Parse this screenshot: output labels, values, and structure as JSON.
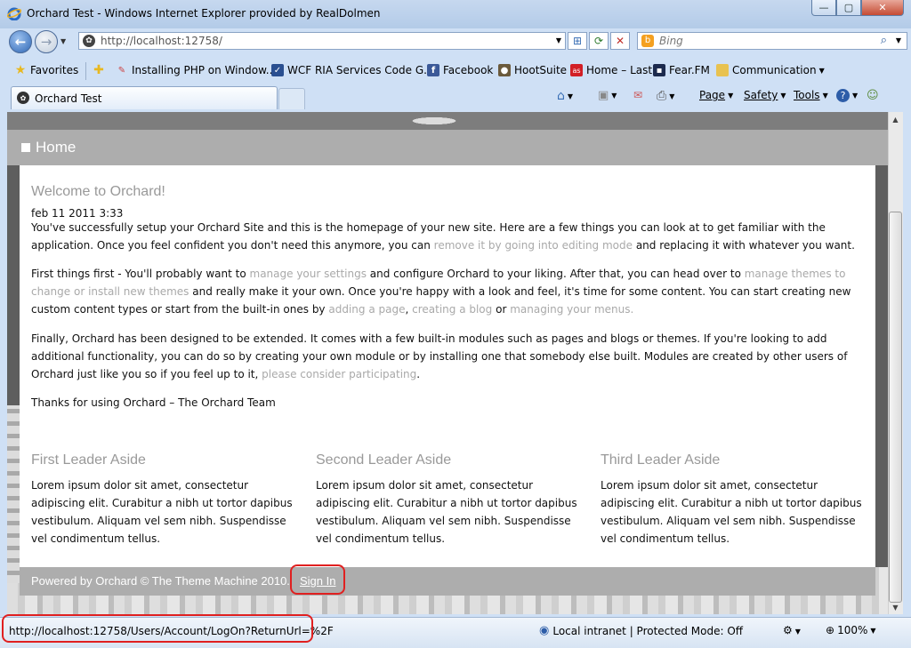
{
  "window": {
    "title": "Orchard Test - Windows Internet Explorer provided by RealDolmen",
    "min_glyph": "—",
    "max_glyph": "▢",
    "close_glyph": "✕"
  },
  "address_bar": {
    "url": "http://localhost:12758/",
    "search_placeholder": "Bing"
  },
  "favorites_bar": {
    "favorites_label": "Favorites",
    "items": [
      {
        "label": "Installing PHP on Window...",
        "icon": "pencil-icon"
      },
      {
        "label": "WCF RIA Services Code G...",
        "icon": "wcf-icon"
      },
      {
        "label": "Facebook",
        "icon": "facebook-icon"
      },
      {
        "label": "HootSuite",
        "icon": "owl-icon"
      },
      {
        "label": "Home – Last",
        "icon": "lastfm-icon"
      },
      {
        "label": "Fear.FM",
        "icon": "fearfm-icon"
      },
      {
        "label": "Communication",
        "icon": "folder-icon"
      }
    ]
  },
  "tabs": {
    "active_label": "Orchard Test"
  },
  "command_bar": {
    "page": "Page",
    "safety": "Safety",
    "tools": "Tools"
  },
  "site": {
    "home_title": "Home",
    "welcome_heading": "Welcome to Orchard!",
    "date": "feb 11 2011 3:33",
    "p1_a": "You've successfully setup your Orchard Site and this is the homepage of your new site. Here are a few things you can look at to get familiar with the application. Once you feel confident you don't need this anymore, you can ",
    "p1_link": "remove it by going into editing mode",
    "p1_b": " and replacing it with whatever you want.",
    "p2_a": "First things first - You'll probably want to ",
    "p2_link1": "manage your settings",
    "p2_b": " and configure Orchard to your liking. After that, you can head over to ",
    "p2_link2": "manage themes to change or install new themes",
    "p2_c": " and really make it your own. Once you're happy with a look and feel, it's time for some content. You can start creating new custom content types or start from the built-in ones by ",
    "p2_link3": "adding a page",
    "p2_d": ", ",
    "p2_link4": "creating a blog",
    "p2_e": " or ",
    "p2_link5": "managing your menus.",
    "p3_a": "Finally, Orchard has been designed to be extended. It comes with a few built-in modules such as pages and blogs or themes. If you're looking to add additional functionality, you can do so by creating your own module or by installing one that somebody else built. Modules are created by other users of Orchard just like you so if you feel up to it, ",
    "p3_link": "please consider participating",
    "p3_b": ".",
    "thanks": "Thanks for using Orchard – The Orchard Team",
    "asides": [
      {
        "title": "First Leader Aside",
        "body": "Lorem ipsum dolor sit amet, consectetur adipiscing elit. Curabitur a nibh ut tortor dapibus vestibulum. Aliquam vel sem nibh. Suspendisse vel condimentum tellus."
      },
      {
        "title": "Second Leader Aside",
        "body": "Lorem ipsum dolor sit amet, consectetur adipiscing elit. Curabitur a nibh ut tortor dapibus vestibulum. Aliquam vel sem nibh. Suspendisse vel condimentum tellus."
      },
      {
        "title": "Third Leader Aside",
        "body": "Lorem ipsum dolor sit amet, consectetur adipiscing elit. Curabitur a nibh ut tortor dapibus vestibulum. Aliquam vel sem nibh. Suspendisse vel condimentum tellus."
      }
    ],
    "footer": "Powered by Orchard © The Theme Machine 2010.",
    "sign_in": "Sign In"
  },
  "status_bar": {
    "url": "http://localhost:12758/Users/Account/LogOn?ReturnUrl=%2F",
    "zone": "Local intranet | Protected Mode: Off",
    "zoom": "100%"
  },
  "colors": {
    "link": "#a9a9a9",
    "header_bar": "#adadad",
    "highlight": "#e02020"
  }
}
